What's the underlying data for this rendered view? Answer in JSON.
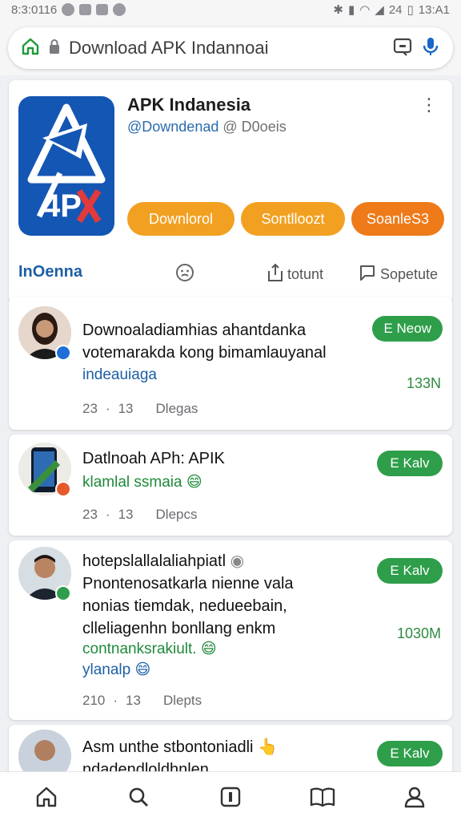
{
  "status_bar": {
    "time_left": "8:3:0116",
    "time_right": "13:A1",
    "signal_text": "24"
  },
  "browser": {
    "url": "Download APK Indannoai"
  },
  "profile": {
    "name": "APK Indanesia",
    "handle": "@Downdenad",
    "handle_suffix": "D0oeis",
    "logo_text": "4P",
    "buttons": {
      "download": "Downlorol",
      "subscribe": "Sontlloozt",
      "share": "SoanleS3"
    },
    "tabs": {
      "home": "InOenna",
      "comment": "totunt",
      "support": "Sopetute"
    }
  },
  "posts": [
    {
      "title": "Downoaladiamhias ahantdanka votemarakda kong bimamlauyanal",
      "sub": "indeauiaga",
      "meta_a": "23",
      "meta_b": "13",
      "meta_c": "Dlegas",
      "pill": "E Neow",
      "count": "133N"
    },
    {
      "title": "Datlnoah APh: APIK",
      "sub": "klamlal ssmaia",
      "emoji": "😄",
      "meta_a": "23",
      "meta_b": "13",
      "meta_c": "Dlepcs",
      "pill": "E Kalv"
    },
    {
      "title": "hotepslallalaliahpiatl",
      "line2": "Pnontenosatkarla nienne vala",
      "line3": "nonias tiemdak, nedueebain,",
      "line4": "clleliagenhn bonllang enkm",
      "sub": "contnanksrakiult.",
      "sub2": "ylanalp",
      "emoji": "😄",
      "emoji2": "😄",
      "meta_a": "210",
      "meta_b": "13",
      "meta_c": "Dlepts",
      "pill": "E Kalv",
      "count": "1030M"
    },
    {
      "title": "Asm unthe stbontoniadli",
      "line2": "ndadendloldhnlen",
      "pill": "E Kalv"
    }
  ],
  "colors": {
    "brand_blue": "#1456b3",
    "accent_orange": "#f2a021",
    "green": "#2e9e4a"
  },
  "icons": {
    "nav": [
      "home-icon",
      "search-icon",
      "library-icon",
      "book-icon",
      "profile-icon"
    ]
  }
}
